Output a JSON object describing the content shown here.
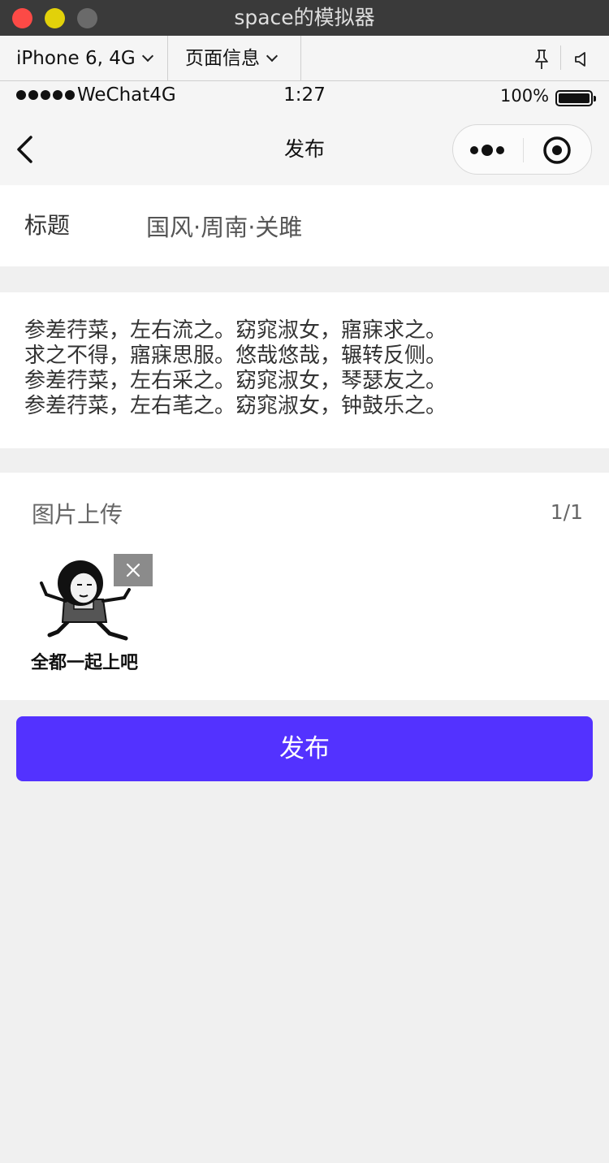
{
  "window": {
    "title": "space的模拟器"
  },
  "toolbar": {
    "device": "iPhone 6, 4G",
    "page_info": "页面信息"
  },
  "statusbar": {
    "carrier": "WeChat4G",
    "time": "1:27",
    "battery": "100%"
  },
  "navbar": {
    "title": "发布"
  },
  "form": {
    "title_label": "标题",
    "title_value": "国风·周南·关雎",
    "content_lines": [
      "参差荇菜，左右流之。窈窕淑女，寤寐求之。",
      "求之不得，寤寐思服。悠哉悠哉，辗转反侧。",
      "参差荇菜，左右采之。窈窕淑女，琴瑟友之。",
      "参差荇菜，左右芼之。窈窕淑女，钟鼓乐之。"
    ],
    "upload_label": "图片上传",
    "upload_count": "1/1",
    "image_caption": "全都一起上吧"
  },
  "publish_button": {
    "label": "发布"
  },
  "colors": {
    "accent": "#5332ff",
    "background": "#f0f0f0",
    "titlebar": "#3a3a3a"
  }
}
